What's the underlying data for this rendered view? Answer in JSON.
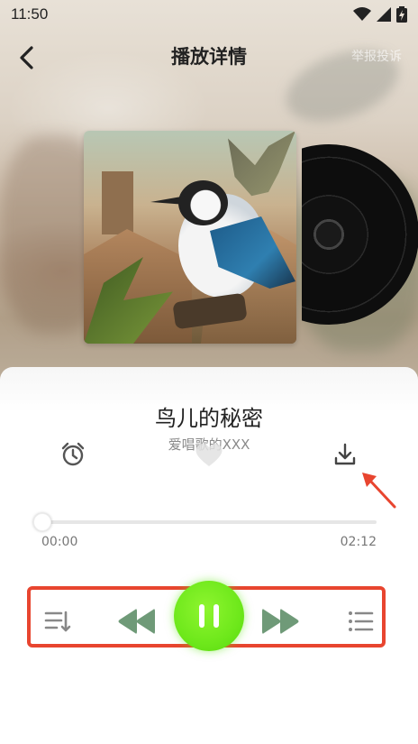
{
  "status_bar": {
    "time": "11:50"
  },
  "header": {
    "title": "播放详情",
    "report_label": "举报投诉"
  },
  "song": {
    "title": "鸟儿的秘密",
    "artist": "爱唱歌的XXX"
  },
  "progress": {
    "current_time": "00:00",
    "total_time": "02:12",
    "fraction": 0.0
  },
  "icons": {
    "back": "chevron-left-icon",
    "alarm": "alarm-clock-icon",
    "like": "heart-icon",
    "download": "download-icon",
    "queue": "queue-order-icon",
    "prev": "rewind-icon",
    "play_pause": "pause-icon",
    "next": "fast-forward-icon",
    "playlist": "playlist-icon"
  },
  "colors": {
    "play_button": "#6ee81b",
    "control_icons": "#6f9a78",
    "annotation": "#e8452f"
  }
}
